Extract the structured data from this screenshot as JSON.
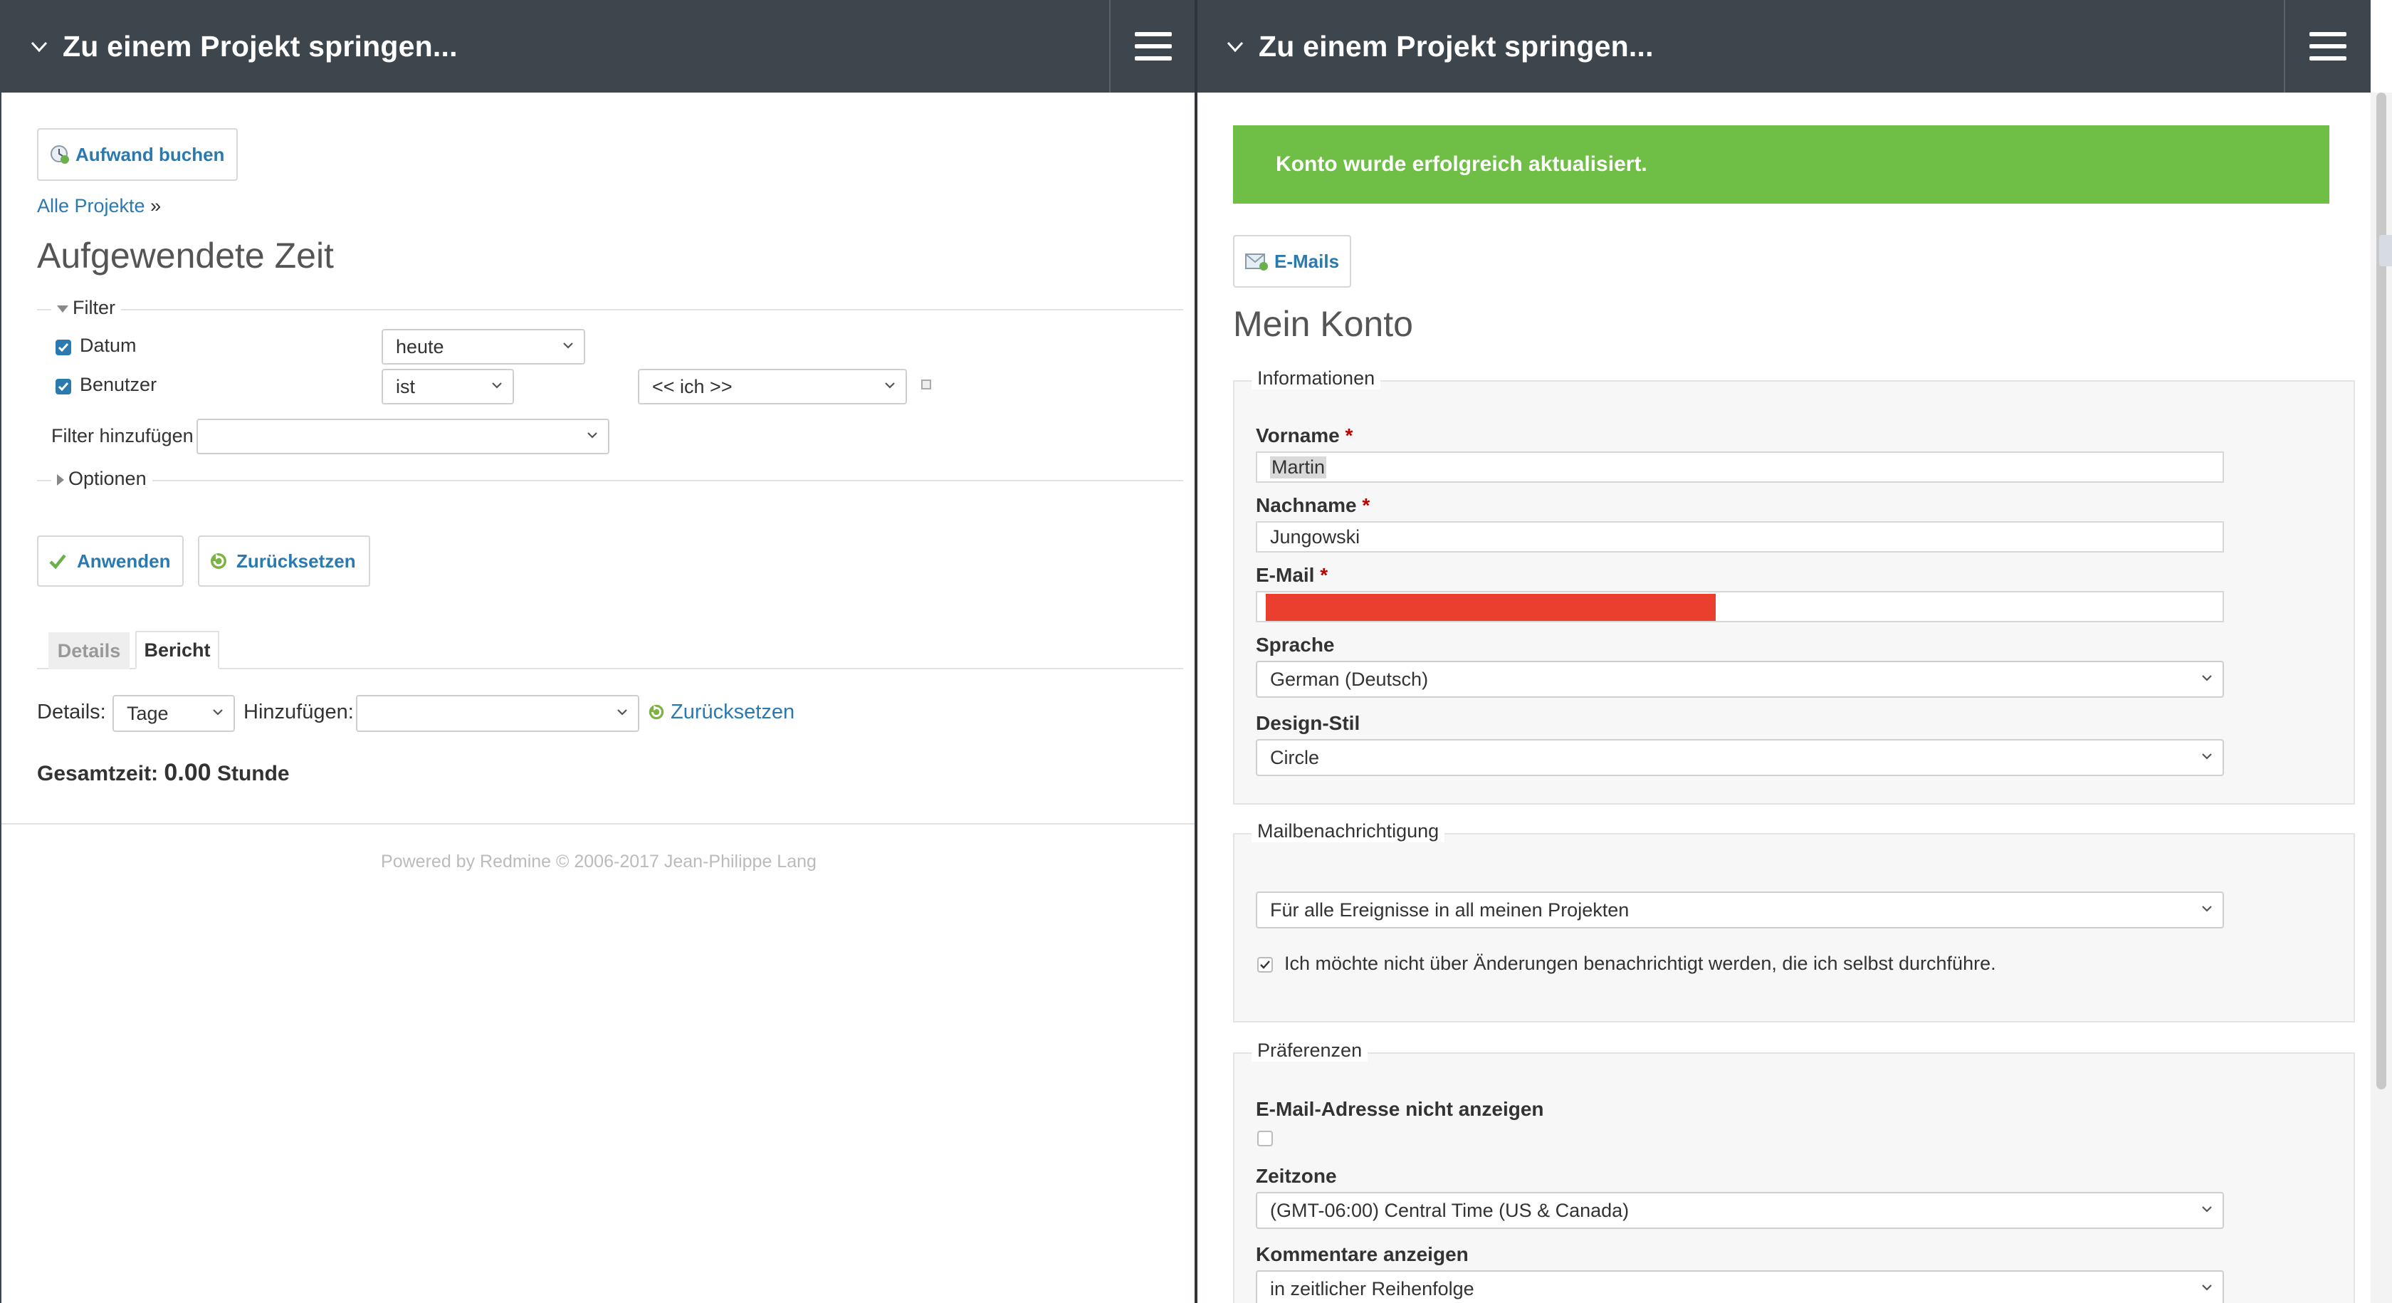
{
  "left": {
    "topbar": {
      "jump_label": "Zu einem Projekt springen..."
    },
    "log_time_button": "Aufwand buchen",
    "breadcrumb": {
      "link": "Alle Projekte",
      "sep": "»"
    },
    "title": "Aufgewendete Zeit",
    "filter_legend": "Filter",
    "filters": {
      "date": {
        "label": "Datum",
        "operator": "heute"
      },
      "user": {
        "label": "Benutzer",
        "operator": "ist",
        "value": "<< ich >>"
      },
      "add_label": "Filter hinzufügen",
      "add_value": ""
    },
    "options_legend": "Optionen",
    "apply_button": "Anwenden",
    "reset_button": "Zurücksetzen",
    "tabs": {
      "details": "Details",
      "report": "Bericht"
    },
    "report": {
      "details_label": "Details:",
      "details_value": "Tage",
      "add_label": "Hinzufügen:",
      "add_value": "",
      "reset_link": "Zurücksetzen"
    },
    "total": {
      "label": "Gesamtzeit:",
      "value": "0.00",
      "unit": "Stunde"
    },
    "footer": "Powered by Redmine © 2006-2017 Jean-Philippe Lang"
  },
  "right": {
    "topbar": {
      "jump_label": "Zu einem Projekt springen..."
    },
    "notice": "Konto wurde erfolgreich aktualisiert.",
    "emails_button": "E-Mails",
    "title": "Mein Konto",
    "info_legend": "Informationen",
    "firstname": {
      "label": "Vorname",
      "value": "Martin"
    },
    "lastname": {
      "label": "Nachname",
      "value": "Jungowski"
    },
    "email": {
      "label": "E-Mail",
      "value": ""
    },
    "required_mark": "*",
    "language": {
      "label": "Sprache",
      "value": "German (Deutsch)"
    },
    "theme": {
      "label": "Design-Stil",
      "value": "Circle"
    },
    "mail_legend": "Mailbenachrichtigung",
    "mail_notification": "Für alle Ereignisse in all meinen Projekten",
    "no_self_notified": "Ich möchte nicht über Änderungen benachrichtigt werden, die ich selbst durchführe.",
    "prefs_legend": "Präferenzen",
    "hide_mail_label": "E-Mail-Adresse nicht anzeigen",
    "timezone": {
      "label": "Zeitzone",
      "value": "(GMT-06:00) Central Time (US & Canada)"
    },
    "comments": {
      "label": "Kommentare anzeigen",
      "value": "in zeitlicher Reihenfolge"
    }
  },
  "colors": {
    "header": "#3d454d",
    "link": "#2a7ab0",
    "notice": "#6fbe45",
    "checkbox": "#2a7ab0",
    "redaction": "#ea3f2e"
  }
}
